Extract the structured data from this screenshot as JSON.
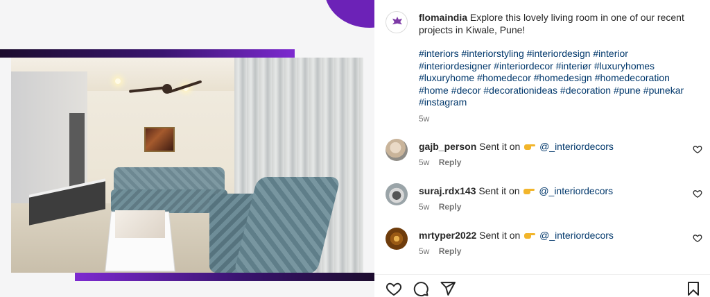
{
  "post": {
    "username": "flomaindia",
    "caption": "Explore this lovely living room in one of our recent projects in Kiwale, Pune!",
    "hashtags": "#interiors #interiorstyling #interiordesign #interior #interiordesigner #interiordecor #interiør #luxuryhomes #luxuryhome #homedecor #homedesign #homedecoration #home #decor #decorationideas #decoration #pune #punekar #instagram",
    "time": "5w"
  },
  "comments": [
    {
      "username": "gajb_person",
      "text_before": "Sent it on",
      "mention": "@_interiordecors",
      "time": "5w",
      "reply": "Reply"
    },
    {
      "username": "suraj.rdx143",
      "text_before": "Sent it on",
      "mention": "@_interiordecors",
      "time": "5w",
      "reply": "Reply"
    },
    {
      "username": "mrtyper2022",
      "text_before": "Sent it on",
      "mention": "@_interiordecors",
      "time": "5w",
      "reply": "Reply"
    }
  ],
  "icons": {
    "like": "heart-icon",
    "comment": "comment-icon",
    "share": "share-icon",
    "save": "bookmark-icon",
    "comment_like": "heart-icon",
    "emoji": "pointing-hand-icon"
  },
  "colors": {
    "accent_purple": "#6c22b7",
    "link_blue": "#00376b",
    "muted": "#737373"
  }
}
